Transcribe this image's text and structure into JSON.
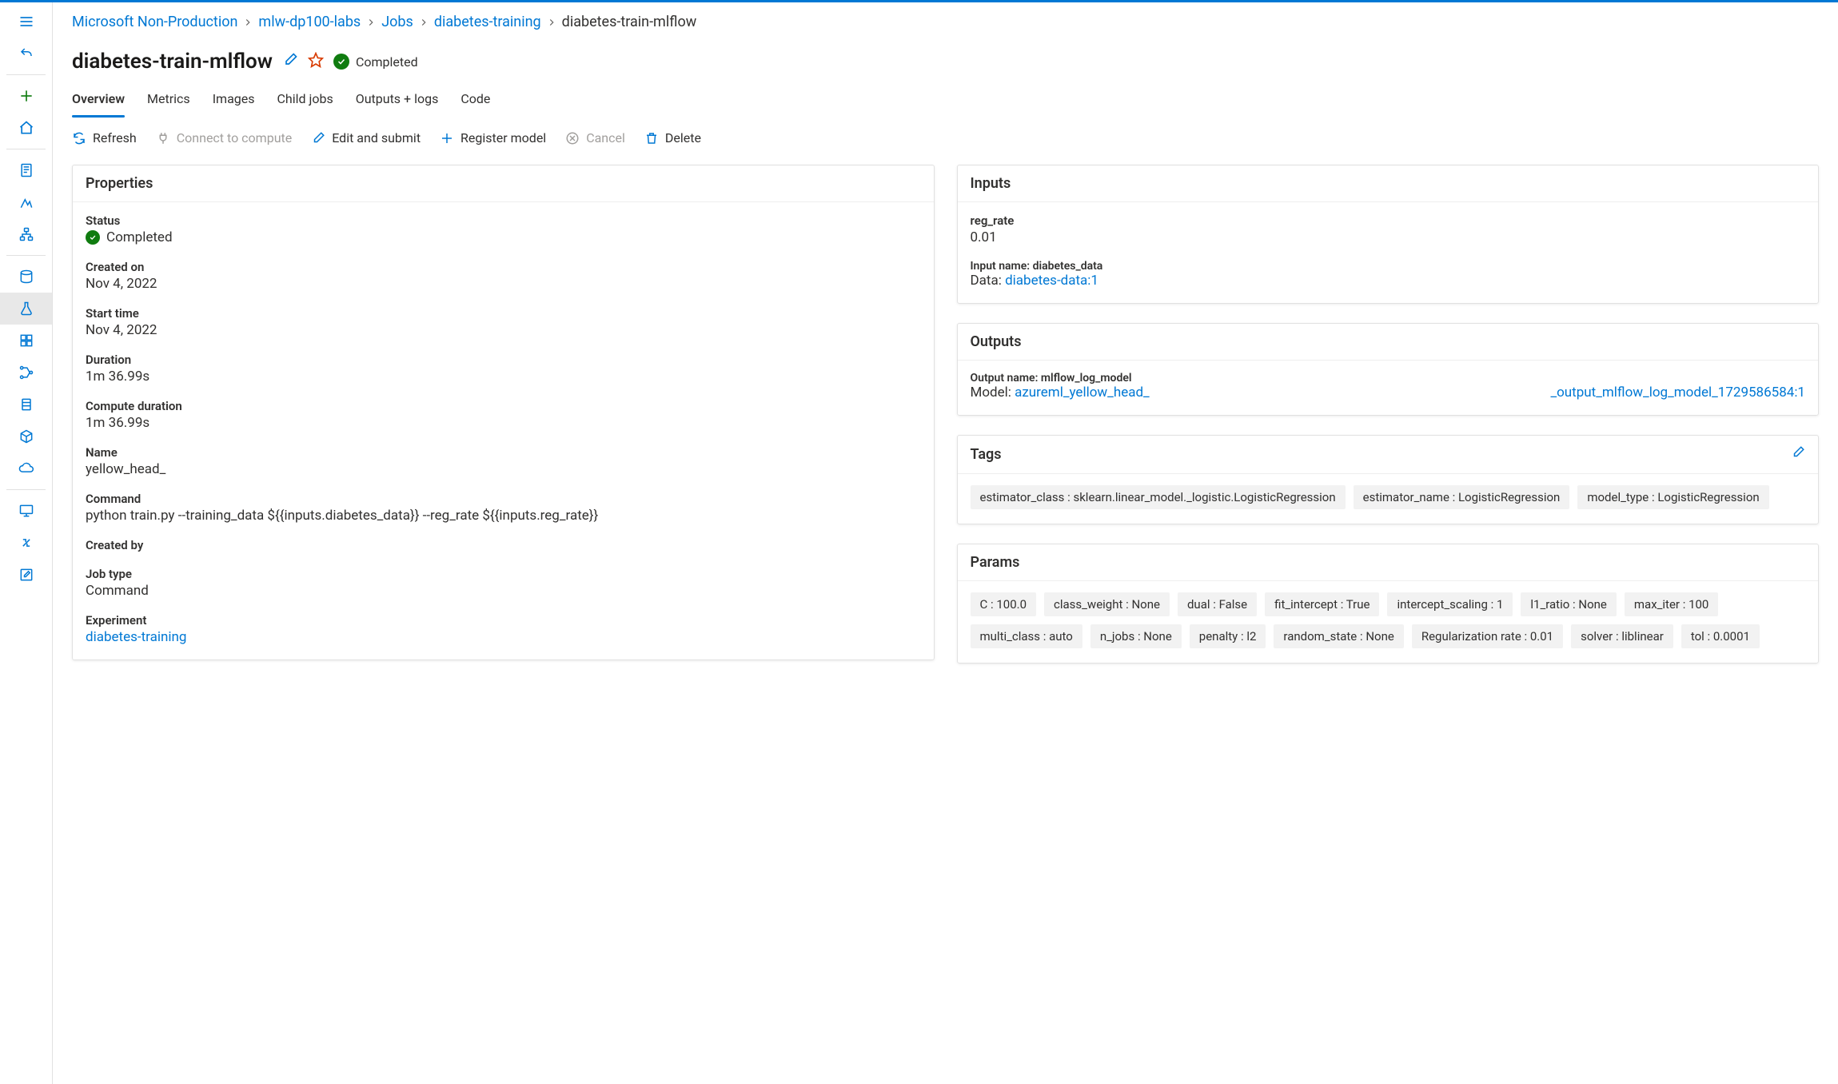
{
  "breadcrumbs": [
    {
      "label": "Microsoft Non-Production",
      "link": true
    },
    {
      "label": "mlw-dp100-labs",
      "link": true
    },
    {
      "label": "Jobs",
      "link": true
    },
    {
      "label": "diabetes-training",
      "link": true
    },
    {
      "label": "diabetes-train-mlflow",
      "link": false
    }
  ],
  "title": "diabetes-train-mlflow",
  "status_badge": "Completed",
  "tabs": [
    "Overview",
    "Metrics",
    "Images",
    "Child jobs",
    "Outputs + logs",
    "Code"
  ],
  "active_tab": 0,
  "toolbar": {
    "refresh": "Refresh",
    "connect": "Connect to compute",
    "edit": "Edit and submit",
    "register": "Register model",
    "cancel": "Cancel",
    "delete": "Delete"
  },
  "properties": {
    "title": "Properties",
    "status_label": "Status",
    "status_value": "Completed",
    "created_on_label": "Created on",
    "created_on_value": "Nov 4, 2022",
    "start_time_label": "Start time",
    "start_time_value": "Nov 4, 2022",
    "duration_label": "Duration",
    "duration_value": "1m 36.99s",
    "compute_duration_label": "Compute duration",
    "compute_duration_value": "1m 36.99s",
    "name_label": "Name",
    "name_value": "yellow_head_",
    "command_label": "Command",
    "command_value": "python train.py --training_data ${{inputs.diabetes_data}} --reg_rate ${{inputs.reg_rate}}",
    "created_by_label": "Created by",
    "created_by_value": "",
    "job_type_label": "Job type",
    "job_type_value": "Command",
    "experiment_label": "Experiment",
    "experiment_value": "diabetes-training"
  },
  "inputs": {
    "title": "Inputs",
    "reg_rate_label": "reg_rate",
    "reg_rate_value": "0.01",
    "input_name_label": "Input name:",
    "input_name_value": "diabetes_data",
    "data_label": "Data:",
    "data_link": "diabetes-data:1"
  },
  "outputs": {
    "title": "Outputs",
    "output_name_label": "Output name:",
    "output_name_value": "mlflow_log_model",
    "model_label": "Model:",
    "model_link_a": "azureml_yellow_head_",
    "model_link_b": "_output_mlflow_log_model_1729586584:1"
  },
  "tags": {
    "title": "Tags",
    "items": [
      "estimator_class : sklearn.linear_model._logistic.LogisticRegression",
      "estimator_name : LogisticRegression",
      "model_type : LogisticRegression"
    ]
  },
  "params": {
    "title": "Params",
    "items": [
      "C : 100.0",
      "class_weight : None",
      "dual : False",
      "fit_intercept : True",
      "intercept_scaling : 1",
      "l1_ratio : None",
      "max_iter : 100",
      "multi_class : auto",
      "n_jobs : None",
      "penalty : l2",
      "random_state : None",
      "Regularization rate : 0.01",
      "solver : liblinear",
      "tol : 0.0001"
    ]
  }
}
